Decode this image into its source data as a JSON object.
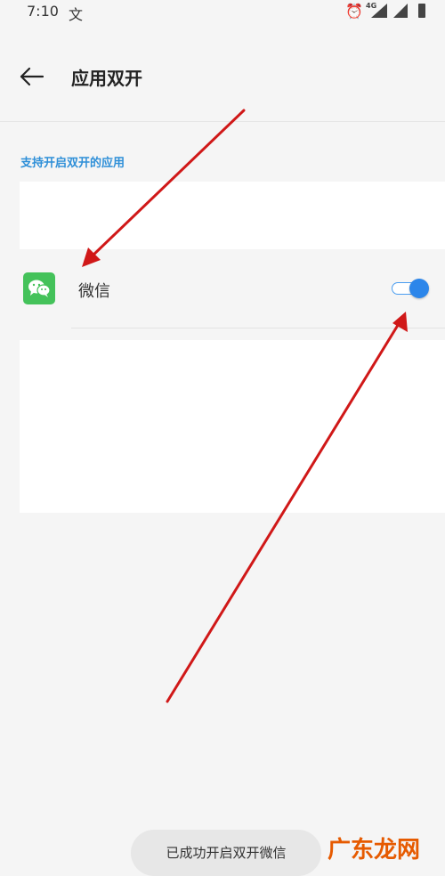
{
  "status_bar": {
    "time": "7:10",
    "extra_glyph": "文",
    "network_type": "4G",
    "icons": [
      "alarm-icon",
      "signal-icon",
      "signal-icon",
      "battery-icon"
    ]
  },
  "header": {
    "title": "应用双开",
    "back_icon": "arrow-left-icon"
  },
  "section": {
    "label": "支持开启双开的应用"
  },
  "apps": [
    {
      "name": "微信",
      "icon": "wechat-icon",
      "enabled": true
    }
  ],
  "toast": {
    "message": "已成功开启双开微信"
  },
  "watermark": {
    "text": "广东龙网"
  },
  "colors": {
    "accent": "#2c86ea",
    "section_label": "#2e8fd8",
    "annotation_arrow": "#d01818",
    "wechat_green": "#44c25a",
    "watermark": "#e65a00"
  }
}
